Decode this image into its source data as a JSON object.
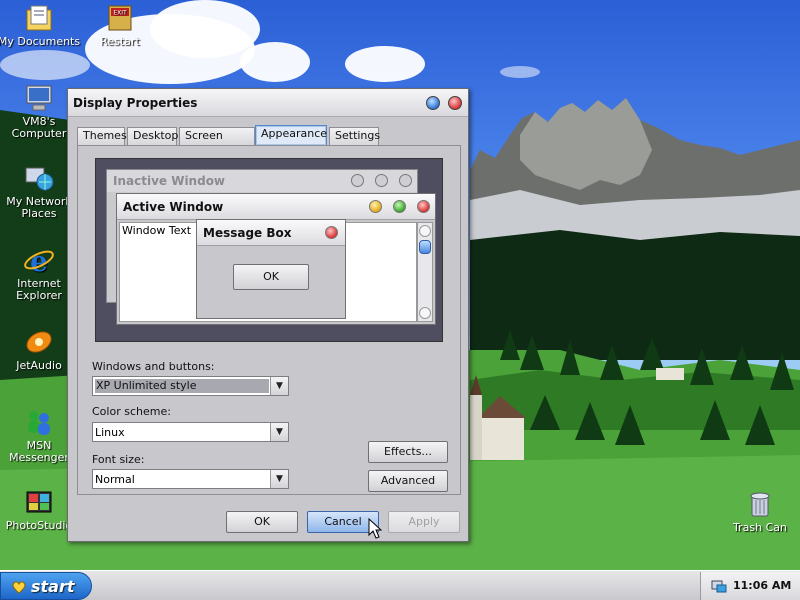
{
  "desktop": {
    "icons": [
      {
        "label": "My Documents"
      },
      {
        "label": "Restart"
      },
      {
        "label": "VM8's Computer"
      },
      {
        "label": "My Network Places"
      },
      {
        "label": "Internet Explorer"
      },
      {
        "label": "JetAudio"
      },
      {
        "label": "MSN Messenger"
      },
      {
        "label": "PhotoStudio"
      },
      {
        "label": "Trash Can"
      }
    ]
  },
  "dialog": {
    "title": "Display Properties",
    "tabs": [
      "Themes",
      "Desktop",
      "Screen Saver",
      "Appearance",
      "Settings"
    ],
    "active_tab": "Appearance",
    "preview": {
      "inactive_title": "Inactive Window",
      "active_title": "Active Window",
      "window_text": "Window Text",
      "message_box_title": "Message Box",
      "message_box_ok": "OK"
    },
    "windows_buttons": {
      "label": "Windows and buttons:",
      "value": "XP Unlimited style"
    },
    "color_scheme": {
      "label": "Color scheme:",
      "value": "Linux"
    },
    "font_size": {
      "label": "Font size:",
      "value": "Normal"
    },
    "effects_label": "Effects...",
    "advanced_label": "Advanced",
    "ok_label": "OK",
    "cancel_label": "Cancel",
    "apply_label": "Apply"
  },
  "taskbar": {
    "start_label": "start",
    "clock": "11:06 AM"
  },
  "colors": {
    "sky": "#2b5fd6",
    "grass": "#4ba238",
    "dialog_bg": "#c7c7cc",
    "preview_bg": "#4e4e60",
    "start_blue": "#1d66c9"
  }
}
